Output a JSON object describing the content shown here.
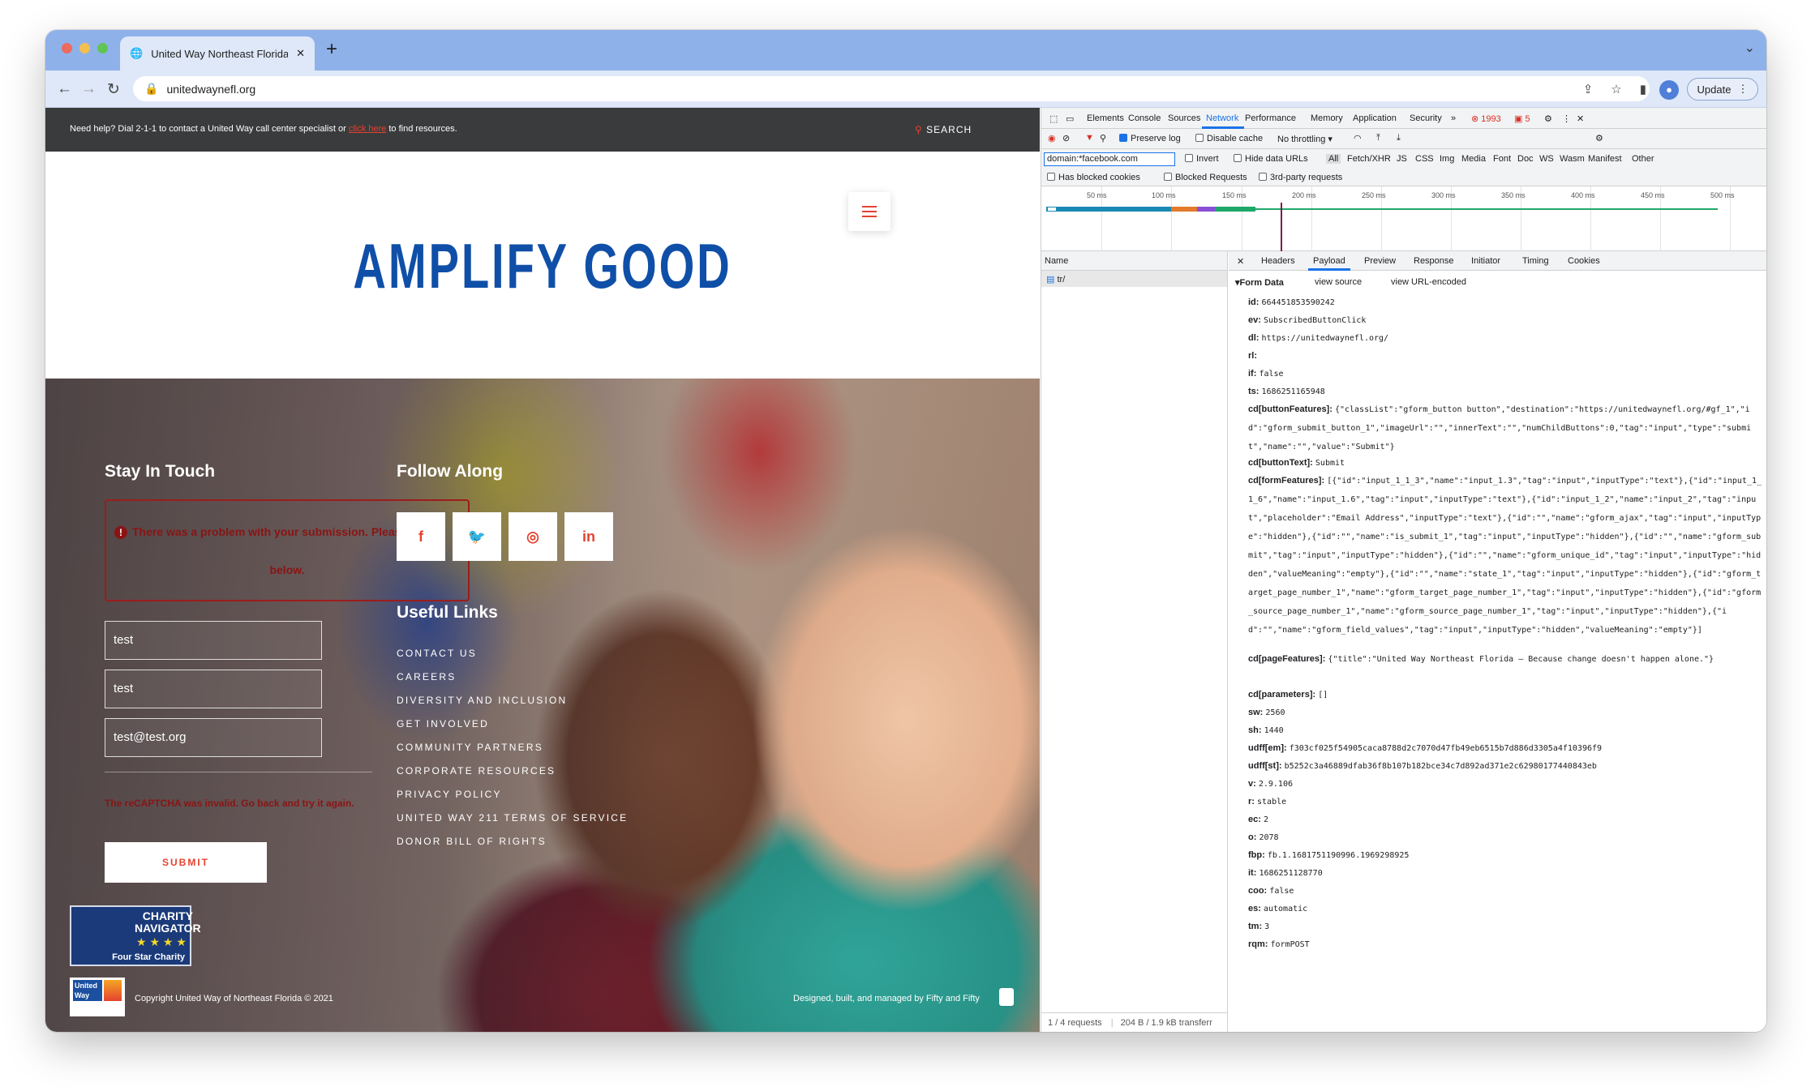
{
  "browser": {
    "tab_title": "United Way Northeast Florida -",
    "url": "unitedwaynefl.org",
    "update_label": "Update"
  },
  "site": {
    "help_text_before": "Need help? Dial 2-1-1 to contact a United Way call center specialist or ",
    "help_link": "click here",
    "help_text_after": " to find resources.",
    "search_label": "SEARCH",
    "hero_title": "AMPLIFY GOOD",
    "stay_in_touch": "Stay In Touch",
    "follow_along": "Follow Along",
    "error_line1": "There was a problem with your submission. Please re",
    "error_line1_tail": "el",
    "error_line2": "below.",
    "fields": [
      "test",
      "test",
      "test@test.org"
    ],
    "captcha_error": "The reCAPTCHA was invalid. Go back and try it again.",
    "submit_label": "SUBMIT",
    "social": [
      "f",
      "t",
      "ig",
      "in"
    ],
    "useful_links_title": "Useful Links",
    "links": [
      "CONTACT US",
      "CAREERS",
      "DIVERSITY AND INCLUSION",
      "GET INVOLVED",
      "COMMUNITY PARTNERS",
      "CORPORATE RESOURCES",
      "PRIVACY POLICY",
      "UNITED WAY 211 TERMS OF SERVICE",
      "DONOR BILL OF RIGHTS"
    ],
    "charity_a": "CHARITY",
    "charity_b": "NAVIGATOR",
    "charity_stars": "★ ★ ★ ★",
    "charity_c": "Four Star Charity",
    "uw_logo": "United Way",
    "copyright": "Copyright United Way of Northeast Florida © 2021",
    "designed": "Designed, built, and managed by Fifty and Fifty"
  },
  "devtools": {
    "tabs": [
      "Elements",
      "Console",
      "Sources",
      "Network",
      "Performance",
      "Memory",
      "Application",
      "Security"
    ],
    "errors": "1993",
    "warnings": "5",
    "preserve_log": "Preserve log",
    "disable_cache": "Disable cache",
    "throttling": "No throttling",
    "filter_value": "domain:*facebook.com",
    "invert": "Invert",
    "hide_data_urls": "Hide data URLs",
    "type_filters": [
      "All",
      "Fetch/XHR",
      "JS",
      "CSS",
      "Img",
      "Media",
      "Font",
      "Doc",
      "WS",
      "Wasm",
      "Manifest",
      "Other"
    ],
    "has_blocked_cookies": "Has blocked cookies",
    "blocked_requests": "Blocked Requests",
    "third_party": "3rd-party requests",
    "ticks": [
      "50 ms",
      "100 ms",
      "150 ms",
      "200 ms",
      "250 ms",
      "300 ms",
      "350 ms",
      "400 ms",
      "450 ms",
      "500 ms"
    ],
    "name_header": "Name",
    "request_name": "tr/",
    "footer_requests": "1 / 4 requests",
    "footer_transfer": "204 B / 1.9 kB transferr",
    "detail_tabs": [
      "Headers",
      "Payload",
      "Preview",
      "Response",
      "Initiator",
      "Timing",
      "Cookies"
    ],
    "form_data_title": "▾Form Data",
    "view_source": "view source",
    "view_url_encoded": "view URL-encoded",
    "payload": [
      {
        "k": "id:",
        "v": "664451853590242"
      },
      {
        "k": "ev:",
        "v": "SubscribedButtonClick"
      },
      {
        "k": "dl:",
        "v": "https://unitedwaynefl.org/"
      },
      {
        "k": "rl:",
        "v": ""
      },
      {
        "k": "if:",
        "v": "false"
      },
      {
        "k": "ts:",
        "v": "1686251165948"
      },
      {
        "k": "cd[buttonFeatures]:",
        "v": "{\"classList\":\"gform_button button\",\"destination\":\"https://unitedwaynefl.org/#gf_1\",\"id\":\"gform_submit_button_1\",\"imageUrl\":\"\",\"innerText\":\"\",\"numChildButtons\":0,\"tag\":\"input\",\"type\":\"submit\",\"name\":\"\",\"value\":\"Submit\"}"
      },
      {
        "k": "cd[buttonText]:",
        "v": "Submit"
      },
      {
        "k": "cd[formFeatures]:",
        "v": "[{\"id\":\"input_1_1_3\",\"name\":\"input_1.3\",\"tag\":\"input\",\"inputType\":\"text\"},{\"id\":\"input_1_1_6\",\"name\":\"input_1.6\",\"tag\":\"input\",\"inputType\":\"text\"},{\"id\":\"input_1_2\",\"name\":\"input_2\",\"tag\":\"input\",\"placeholder\":\"Email Address\",\"inputType\":\"text\"},{\"id\":\"\",\"name\":\"gform_ajax\",\"tag\":\"input\",\"inputType\":\"hidden\"},{\"id\":\"\",\"name\":\"is_submit_1\",\"tag\":\"input\",\"inputType\":\"hidden\"},{\"id\":\"\",\"name\":\"gform_submit\",\"tag\":\"input\",\"inputType\":\"hidden\"},{\"id\":\"\",\"name\":\"gform_unique_id\",\"tag\":\"input\",\"inputType\":\"hidden\",\"valueMeaning\":\"empty\"},{\"id\":\"\",\"name\":\"state_1\",\"tag\":\"input\",\"inputType\":\"hidden\"},{\"id\":\"gform_target_page_number_1\",\"name\":\"gform_target_page_number_1\",\"tag\":\"input\",\"inputType\":\"hidden\"},{\"id\":\"gform_source_page_number_1\",\"name\":\"gform_source_page_number_1\",\"tag\":\"input\",\"inputType\":\"hidden\"},{\"id\":\"\",\"name\":\"gform_field_values\",\"tag\":\"input\",\"inputType\":\"hidden\",\"valueMeaning\":\"empty\"}]"
      },
      {
        "k": "cd[pageFeatures]:",
        "v": "{\"title\":\"United Way Northeast Florida – Because change doesn't happen alone.\"}"
      },
      {
        "k": "cd[parameters]:",
        "v": "[]"
      },
      {
        "k": "sw:",
        "v": "2560"
      },
      {
        "k": "sh:",
        "v": "1440"
      },
      {
        "k": "udff[em]:",
        "v": "f303cf025f54905caca8788d2c7070d47fb49eb6515b7d886d3305a4f10396f9"
      },
      {
        "k": "udff[st]:",
        "v": "b5252c3a46889dfab36f8b107b182bce34c7d892ad371e2c62980177440843eb"
      },
      {
        "k": "v:",
        "v": "2.9.106"
      },
      {
        "k": "r:",
        "v": "stable"
      },
      {
        "k": "ec:",
        "v": "2"
      },
      {
        "k": "o:",
        "v": "2078"
      },
      {
        "k": "fbp:",
        "v": "fb.1.1681751190996.1969298925"
      },
      {
        "k": "it:",
        "v": "1686251128770"
      },
      {
        "k": "coo:",
        "v": "false"
      },
      {
        "k": "es:",
        "v": "automatic"
      },
      {
        "k": "tm:",
        "v": "3"
      },
      {
        "k": "rqm:",
        "v": "formPOST"
      }
    ]
  },
  "colors": {
    "accent_red": "#e4432f",
    "brand_blue": "#0f4fa8",
    "devtools_blue": "#1a73e8",
    "error_red": "#8a1414"
  }
}
